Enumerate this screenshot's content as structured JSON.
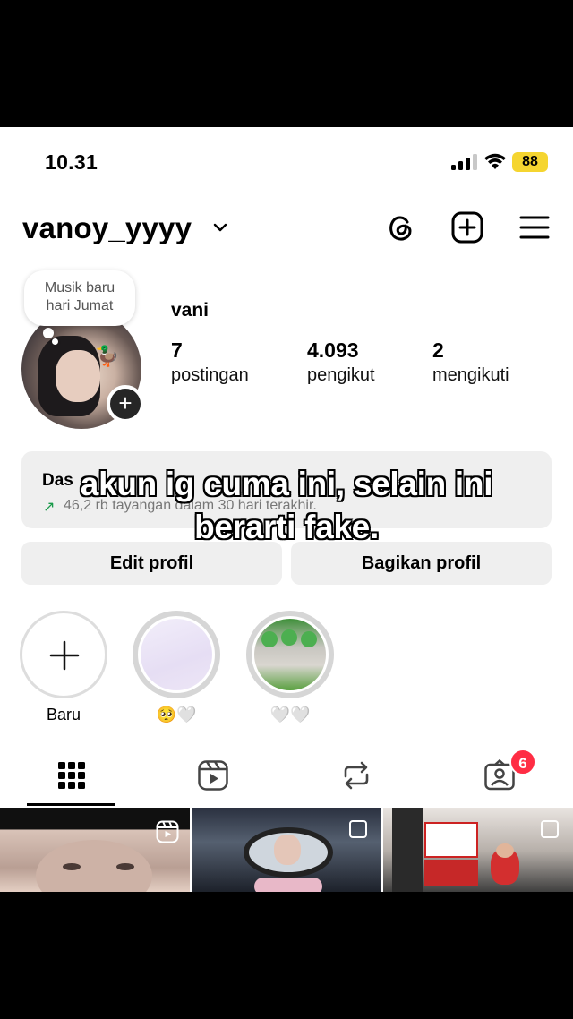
{
  "status_bar": {
    "time": "10.31",
    "battery": "88"
  },
  "header": {
    "username": "vanoy_yyyy"
  },
  "note": {
    "text_line1": "Musik baru",
    "text_line2": "hari Jumat"
  },
  "profile": {
    "display_name": "vani",
    "stats": [
      {
        "value": "7",
        "label": "postingan"
      },
      {
        "value": "4.093",
        "label": "pengikut"
      },
      {
        "value": "2",
        "label": "mengikuti"
      }
    ]
  },
  "dashboard": {
    "title": "Das",
    "subtitle": "46,2 rb tayangan dalam 30 hari terakhir."
  },
  "buttons": {
    "edit_profile": "Edit profil",
    "share_profile": "Bagikan profil"
  },
  "caption": {
    "line1": "akun ig cuma ini, selain ini",
    "line2": "berarti fake."
  },
  "highlights": [
    {
      "label": "Baru"
    },
    {
      "label": "🥺🤍"
    },
    {
      "label": "🤍🤍"
    }
  ],
  "tabs": {
    "tagged_badge": "6"
  },
  "colors": {
    "battery": "#f5d530",
    "badge": "#ff2d44",
    "link_green": "#1a9a4a"
  }
}
